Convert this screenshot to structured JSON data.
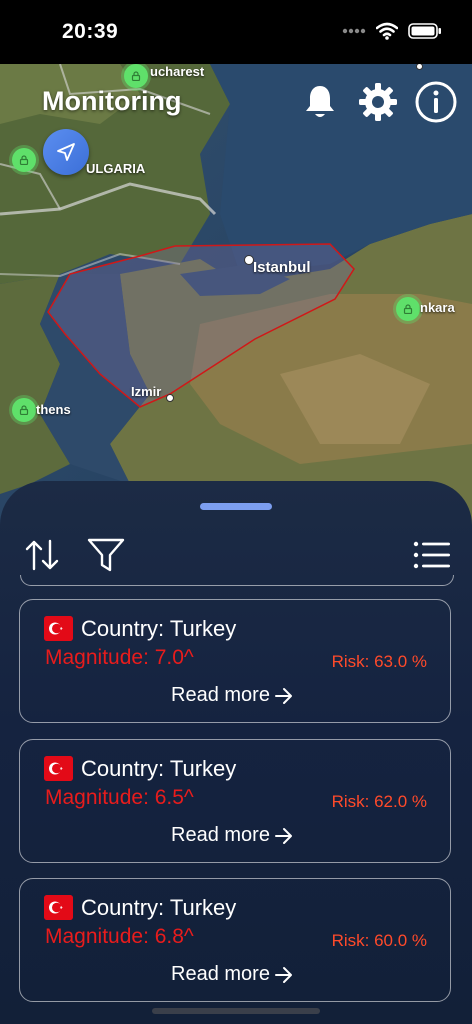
{
  "status_bar": {
    "time": "20:39"
  },
  "header": {
    "title": "Monitoring"
  },
  "map": {
    "cities": [
      {
        "name": "Bucharest",
        "label": "ucharest"
      },
      {
        "name": "Bulgaria",
        "label": "ULGARIA"
      },
      {
        "name": "Istanbul",
        "label": "Istanbul"
      },
      {
        "name": "Ankara",
        "label": "nkara"
      },
      {
        "name": "Izmir",
        "label": "Izmir"
      },
      {
        "name": "Athens",
        "label": "thens"
      }
    ],
    "risk_zone_color": "#d01818",
    "pin_color": "#5fe06a"
  },
  "sheet": {
    "cards": [
      {
        "country": "Country: Turkey",
        "magnitude": "Magnitude: 7.0^",
        "risk": "Risk: 63.0 %",
        "read_more": "Read more"
      },
      {
        "country": "Country: Turkey",
        "magnitude": "Magnitude: 6.5^",
        "risk": "Risk: 62.0 %",
        "read_more": "Read more"
      },
      {
        "country": "Country: Turkey",
        "magnitude": "Magnitude: 6.8^",
        "risk": "Risk: 60.0 %",
        "read_more": "Read more"
      }
    ]
  },
  "colors": {
    "accent": "#5b8ef0",
    "magnitude": "#e81c1c",
    "risk": "#ff4a2a"
  },
  "icons": [
    "bell-icon",
    "gear-icon",
    "info-icon",
    "sort-icon",
    "filter-icon",
    "list-icon",
    "arrow-right-icon",
    "navigation-arrow-icon",
    "lock-icon",
    "turkey-flag-icon"
  ]
}
